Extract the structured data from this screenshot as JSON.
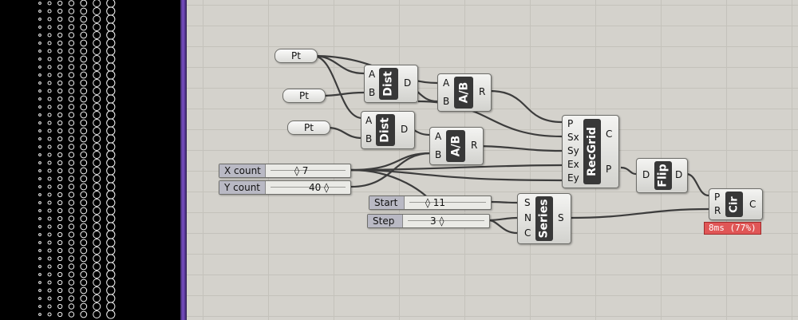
{
  "points": [
    {
      "id": "pt1",
      "label": "Pt"
    },
    {
      "id": "pt2",
      "label": "Pt"
    },
    {
      "id": "pt3",
      "label": "Pt"
    }
  ],
  "components": {
    "dist1": {
      "name": "Dist",
      "inputs": [
        "A",
        "B"
      ],
      "outputs": [
        "D"
      ]
    },
    "dist2": {
      "name": "Dist",
      "inputs": [
        "A",
        "B"
      ],
      "outputs": [
        "D"
      ]
    },
    "div1": {
      "name": "A/B",
      "inputs": [
        "A",
        "B"
      ],
      "outputs": [
        "R"
      ]
    },
    "div2": {
      "name": "A/B",
      "inputs": [
        "A",
        "B"
      ],
      "outputs": [
        "R"
      ]
    },
    "recgrid": {
      "name": "RecGrid",
      "inputs": [
        "P",
        "Sx",
        "Sy",
        "Ex",
        "Ey"
      ],
      "outputs": [
        "C",
        "P"
      ]
    },
    "flip": {
      "name": "Flip",
      "inputs": [
        "D"
      ],
      "outputs": [
        "D"
      ]
    },
    "series": {
      "name": "Series",
      "inputs": [
        "S",
        "N",
        "C"
      ],
      "outputs": [
        "S"
      ]
    },
    "cir": {
      "name": "Cir",
      "inputs": [
        "P",
        "R"
      ],
      "outputs": [
        "C"
      ]
    }
  },
  "sliders": {
    "xcount": {
      "label": "X count",
      "value": "◊ 7"
    },
    "ycount": {
      "label": "Y count",
      "value": "40 ◊"
    },
    "start": {
      "label": "Start",
      "value": "◊ 11"
    },
    "step": {
      "label": "Step",
      "value": "3 ◊"
    }
  },
  "profiler": {
    "text": "8ms  (77%)"
  },
  "colors": {
    "accent_divider": "#7a4fc4",
    "profiler": "#e05656",
    "canvas": "#d4d2cc"
  }
}
